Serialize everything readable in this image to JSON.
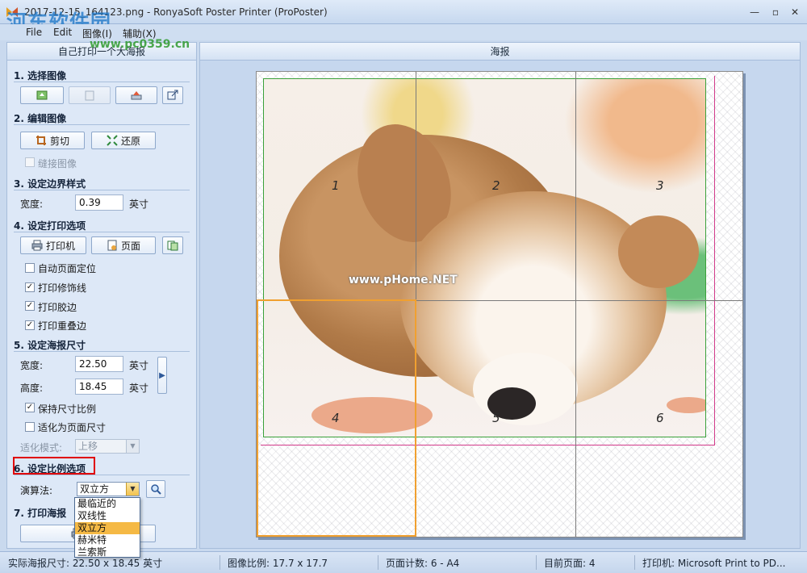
{
  "window": {
    "title": "2017-12-15_164123.png - RonyaSoft Poster Printer (ProPoster)",
    "watermark_site": "河东软件园",
    "watermark_url": "www.pc0359.cn"
  },
  "menu": [
    "File",
    "Edit",
    "图像(I)",
    "辅助(X)"
  ],
  "left_panel": {
    "header": "自己打印一个大海报",
    "sections": {
      "select_image": "1. 选择图像",
      "edit_image": "2. 编辑图像",
      "border_style": "3. 设定边界样式",
      "print_options": "4. 设定打印选项",
      "poster_size": "5. 设定海报尺寸",
      "scale_options": "6. 设定比例选项",
      "print_poster": "7. 打印海报"
    },
    "edit": {
      "crop": "剪切",
      "restore": "还原",
      "stitch": "缝接图像"
    },
    "border": {
      "width_label": "宽度:",
      "width_value": "0.39",
      "unit": "英寸"
    },
    "print": {
      "printer_button": "打印机",
      "page_button": "页面",
      "auto_position": "自动页面定位",
      "print_trim": "打印修饰线",
      "print_glue": "打印胶边",
      "print_overlap": "打印重叠边"
    },
    "size": {
      "width_label": "宽度:",
      "width_value": "22.50",
      "height_label": "高度:",
      "height_value": "18.45",
      "unit": "英寸",
      "keep_ratio": "保持尺寸比例",
      "fit_page": "适化为页面尺寸",
      "fit_mode_label": "适化模式:",
      "fit_mode_value": "上移"
    },
    "scale": {
      "algorithm_label": "演算法:",
      "algorithm_value": "双立方",
      "options": [
        "最临近的",
        "双线性",
        "双立方",
        "赫米特",
        "兰索斯"
      ],
      "selected_index": 2
    },
    "print_button": "打印"
  },
  "right_panel": {
    "header": "海报",
    "page_numbers": [
      "1",
      "2",
      "3",
      "4",
      "5",
      "6"
    ],
    "selected_page": 4,
    "watermark": "www.pHome.NET"
  },
  "status": {
    "actual_size": "实际海报尺寸: 22.50 x 18.45 英寸",
    "image_ratio": "图像比例: 17.7 x 17.7",
    "page_count": "页面计数: 6 - A4",
    "current_page": "目前页面: 4",
    "printer": "打印机: Microsoft Print to PD..."
  },
  "checkbox_states": {
    "stitch": false,
    "auto_position": false,
    "print_trim": true,
    "print_glue": true,
    "print_overlap": true,
    "keep_ratio": true,
    "fit_page": false
  },
  "colors": {
    "accent": "#f5b945",
    "highlight_red": "#e00000",
    "trim_green": "#3aa13a",
    "trim_pink": "#d23a8a"
  }
}
